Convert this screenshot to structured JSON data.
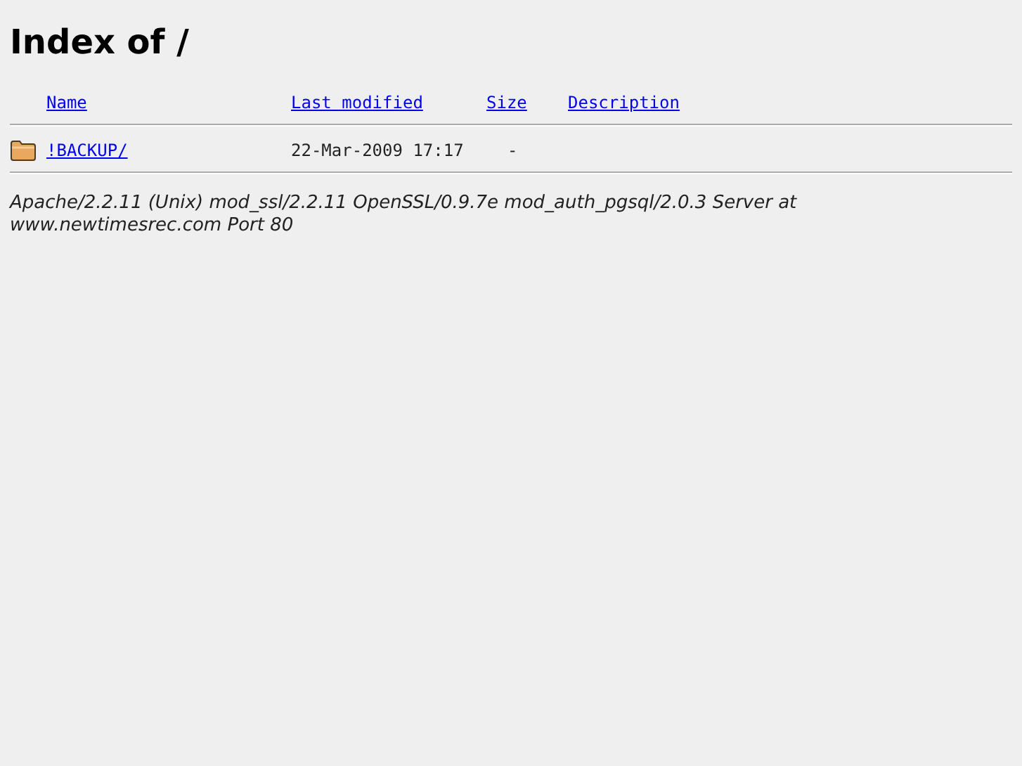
{
  "heading": "Index of /",
  "columns": [
    "Name",
    "Last modified",
    "Size",
    "Description"
  ],
  "rows": [
    {
      "kind": "folder",
      "name": "!BACKUP/",
      "modified": "22-Mar-2009 17:17",
      "size": "-"
    }
  ],
  "footer": "Apache/2.2.11 (Unix) mod_ssl/2.2.11 OpenSSL/0.9.7e mod_auth_pgsql/2.0.3 Server at www.newtimesrec.com Port 80"
}
